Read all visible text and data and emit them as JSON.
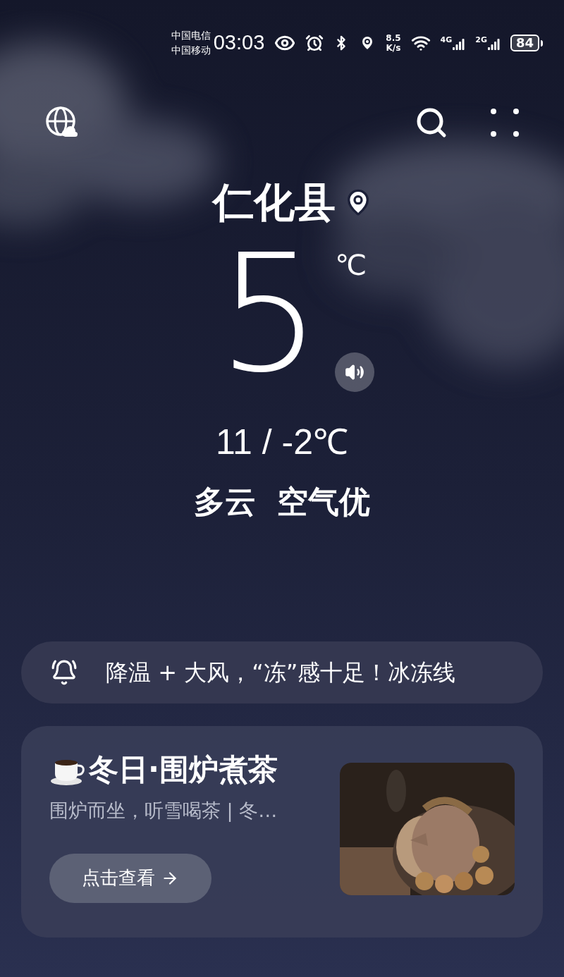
{
  "status_bar": {
    "carriers": [
      "中国电信",
      "中国移动"
    ],
    "time": "03:03",
    "speed": "8.5",
    "speed_unit": "K/s",
    "networks": [
      "4G",
      "2G"
    ],
    "battery": "84"
  },
  "location": {
    "city": "仁化县"
  },
  "current": {
    "temperature": "5",
    "unit": "℃"
  },
  "range": "11 / -2℃",
  "condition": "多云  空气优",
  "alert": {
    "text": "降温 + 大风，“冻”感十足！冰冻线"
  },
  "card": {
    "title": "冬日·围炉煮茶",
    "subtitle": "围炉而坐，听雪喝茶 | 冬…",
    "button": "点击查看"
  }
}
